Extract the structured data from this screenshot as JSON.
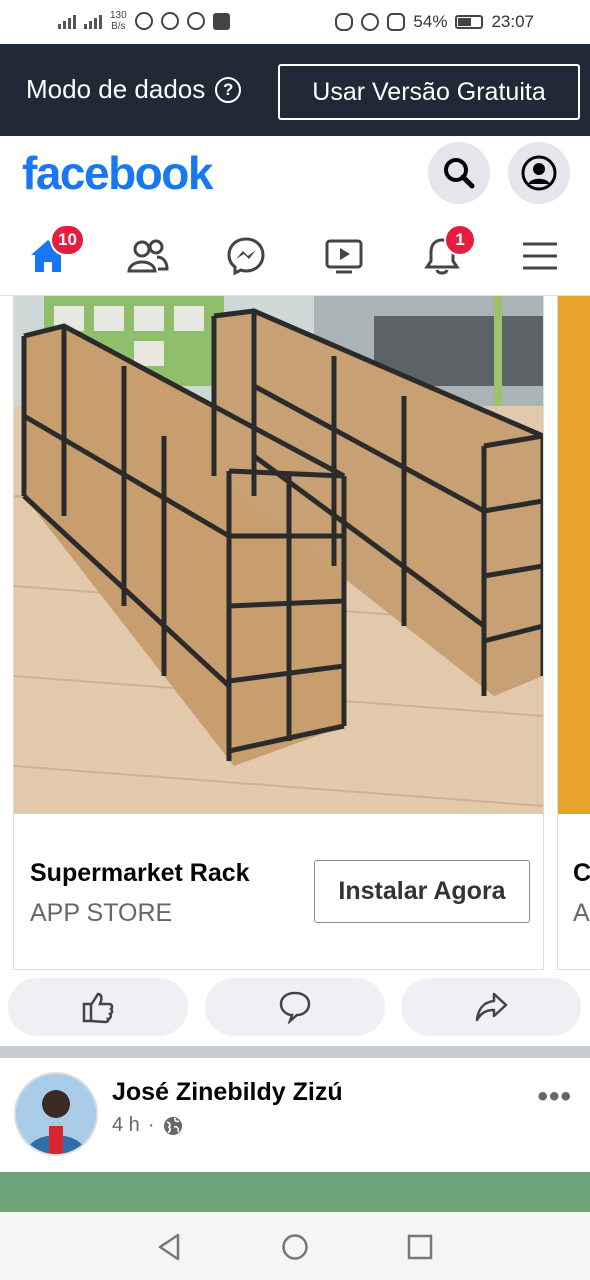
{
  "status_bar": {
    "network_speed_value": "130",
    "network_speed_unit": "B/s",
    "battery": "54%",
    "time": "23:07"
  },
  "data_mode": {
    "label": "Modo de dados",
    "help_symbol": "?",
    "free_version_button": "Usar Versão Gratuita"
  },
  "header": {
    "logo": "facebook",
    "icons": [
      "search-icon",
      "profile-icon"
    ]
  },
  "nav": {
    "home_badge": "10",
    "notifications_badge": "1",
    "icons": [
      "home-icon",
      "friends-icon",
      "messenger-icon",
      "video-icon",
      "bell-icon",
      "menu-icon"
    ],
    "accent_color": "#1877f2",
    "badge_color": "#e41e3f"
  },
  "ad_card": {
    "title": "Supermarket Rack",
    "subtitle": "APP STORE",
    "button": "Instalar Agora"
  },
  "next_card": {
    "title_initial": "C",
    "subtitle_initial": "A"
  },
  "post_actions": [
    "like-icon",
    "comment-icon",
    "share-icon"
  ],
  "post": {
    "author": "José Zinebildy Zizú",
    "time": "4 h",
    "separator": "·",
    "more": "•••"
  }
}
